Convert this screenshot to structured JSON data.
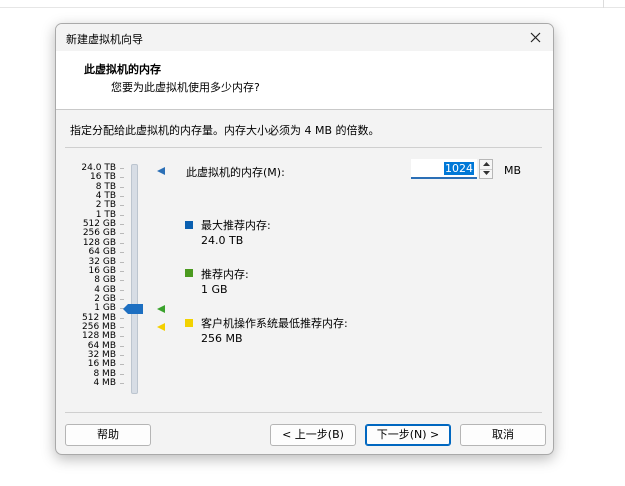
{
  "window": {
    "title": "新建虚拟机向导",
    "close_icon": "close-icon"
  },
  "header": {
    "title": "此虚拟机的内存",
    "subtitle": "您要为此虚拟机使用多少内存?"
  },
  "instruction": "指定分配给此虚拟机的内存量。内存大小必须为 4 MB 的倍数。",
  "scale_labels": [
    "24.0 TB",
    "16 TB",
    "8 TB",
    "4 TB",
    "2 TB",
    "1 TB",
    "512 GB",
    "256 GB",
    "128 GB",
    "64 GB",
    "32 GB",
    "16 GB",
    "8 GB",
    "4 GB",
    "2 GB",
    "1 GB",
    "512 MB",
    "256 MB",
    "128 MB",
    "64 MB",
    "32 MB",
    "16 MB",
    "8 MB",
    "4 MB"
  ],
  "memory": {
    "label": "此虚拟机的内存(M):",
    "value": "1024",
    "unit": "MB",
    "slider_position_label": "1 GB"
  },
  "legend": {
    "max": {
      "title": "最大推荐内存:",
      "value": "24.0 TB",
      "color": "#0a5fb0"
    },
    "recommended": {
      "title": "推荐内存:",
      "value": "1 GB",
      "color": "#4b9a1f"
    },
    "guest_min": {
      "title": "客户机操作系统最低推荐内存:",
      "value": "256 MB",
      "color": "#f2d200"
    }
  },
  "buttons": {
    "help": "帮助",
    "back": "< 上一步(B)",
    "next": "下一步(N) >",
    "cancel": "取消"
  }
}
